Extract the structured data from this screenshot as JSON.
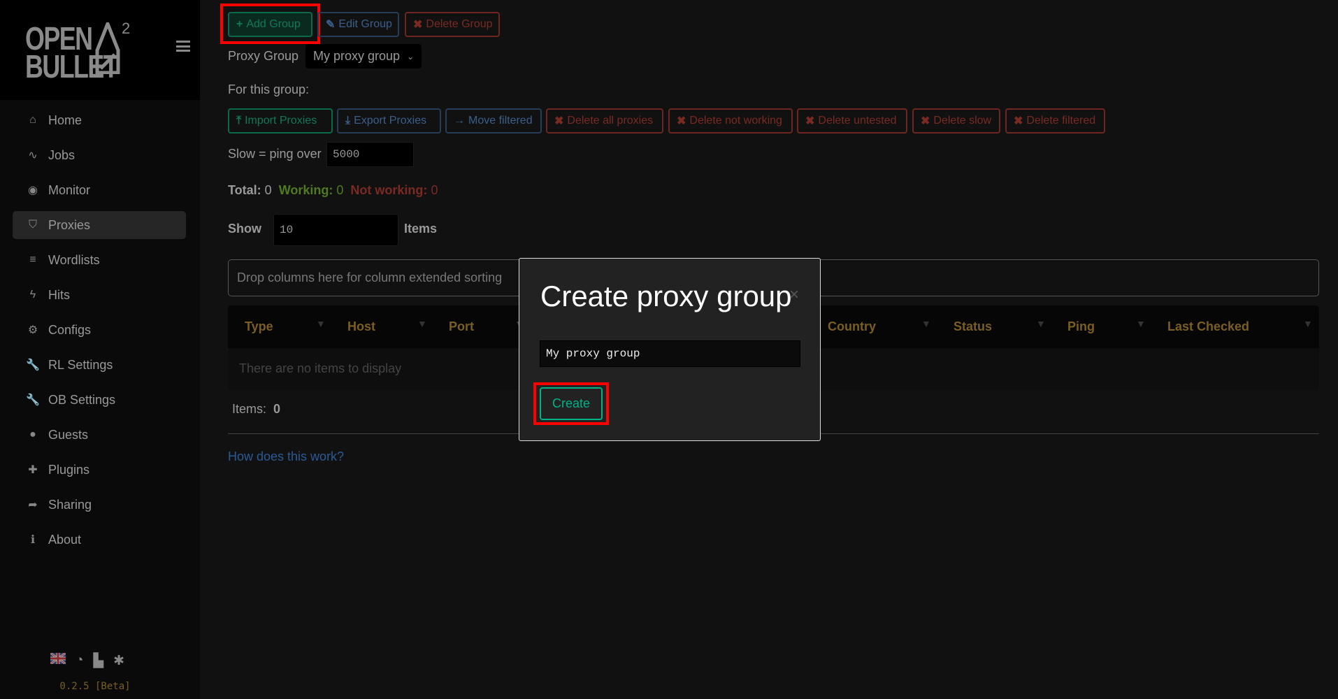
{
  "app": {
    "logo_line1": "OPEN",
    "logo_line2": "BULLET",
    "logo_sup": "2",
    "version": "0.2.5 [Beta]"
  },
  "sidebar": {
    "items": [
      {
        "label": "Home",
        "icon": "home-icon",
        "glyph": "⌂"
      },
      {
        "label": "Jobs",
        "icon": "pulse-icon",
        "glyph": "∿"
      },
      {
        "label": "Monitor",
        "icon": "eye-icon",
        "glyph": "◉"
      },
      {
        "label": "Proxies",
        "icon": "shield-icon",
        "glyph": "⛉",
        "active": true
      },
      {
        "label": "Wordlists",
        "icon": "list-icon",
        "glyph": "≡"
      },
      {
        "label": "Hits",
        "icon": "bolt-icon",
        "glyph": "ϟ"
      },
      {
        "label": "Configs",
        "icon": "gear-icon",
        "glyph": "⚙"
      },
      {
        "label": "RL Settings",
        "icon": "wrench-icon",
        "glyph": "🔧"
      },
      {
        "label": "OB Settings",
        "icon": "wrench-icon",
        "glyph": "🔧"
      },
      {
        "label": "Guests",
        "icon": "user-icon",
        "glyph": "●"
      },
      {
        "label": "Plugins",
        "icon": "puzzle-icon",
        "glyph": "✚"
      },
      {
        "label": "Sharing",
        "icon": "share-icon",
        "glyph": "➦"
      },
      {
        "label": "About",
        "icon": "info-icon",
        "glyph": "ℹ"
      }
    ],
    "footer_icons": [
      "uk-flag-icon",
      "history-icon",
      "book-icon",
      "bug-icon"
    ]
  },
  "toolbar": {
    "add_group": "Add Group",
    "edit_group": "Edit Group",
    "delete_group": "Delete Group"
  },
  "group": {
    "label": "Proxy Group",
    "selected": "My proxy group",
    "for_this_group": "For this group:"
  },
  "actions": [
    "Import Proxies",
    "Export Proxies",
    "Move filtered",
    "Delete all proxies",
    "Delete not working",
    "Delete untested",
    "Delete slow",
    "Delete filtered"
  ],
  "slow": {
    "label": "Slow = ping over",
    "value": "5000"
  },
  "stats": {
    "total_label": "Total:",
    "total": "0",
    "working_label": "Working:",
    "working": "0",
    "not_working_label": "Not working:",
    "not_working": "0"
  },
  "show": {
    "label": "Show",
    "value": "10",
    "suffix": "Items"
  },
  "table": {
    "drop_hint": "Drop columns here for column extended sorting",
    "columns": [
      "Type",
      "Host",
      "Port",
      "Country",
      "Status",
      "Ping",
      "Last Checked"
    ],
    "empty": "There are no items to display",
    "items_label": "Items:",
    "items_count": "0"
  },
  "help_link": "How does this work?",
  "modal": {
    "title": "Create proxy group",
    "close": "×",
    "input_value": "My proxy group",
    "create": "Create"
  },
  "colors": {
    "accent_green": "#00b386",
    "gold": "#7a5e22",
    "danger": "#7a2a22",
    "highlight": "#ff0000"
  }
}
